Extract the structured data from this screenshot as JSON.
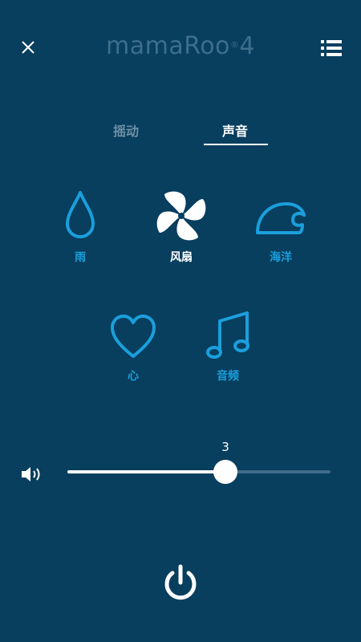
{
  "header": {
    "brand_text": "mamaRoo",
    "brand_reg": "®",
    "brand_num": "4",
    "close_icon": "close-icon",
    "menu_icon": "menu-list-icon"
  },
  "tabs": [
    {
      "label": "摇动",
      "active": false
    },
    {
      "label": "声音",
      "active": true
    }
  ],
  "sounds": [
    {
      "label": "雨",
      "icon": "raindrop-icon",
      "selected": false
    },
    {
      "label": "风扇",
      "icon": "fan-icon",
      "selected": true
    },
    {
      "label": "海洋",
      "icon": "wave-icon",
      "selected": false
    },
    {
      "label": "心",
      "icon": "heart-icon",
      "selected": false
    },
    {
      "label": "音频",
      "icon": "music-note-icon",
      "selected": false
    }
  ],
  "volume": {
    "value": "3",
    "fraction": 0.6,
    "icon": "speaker-icon"
  },
  "power": {
    "icon": "power-icon"
  },
  "colors": {
    "background": "#083e5e",
    "accent": "#1a9fdc",
    "selected": "#ffffff",
    "inactive_tab": "#6f90a6"
  }
}
